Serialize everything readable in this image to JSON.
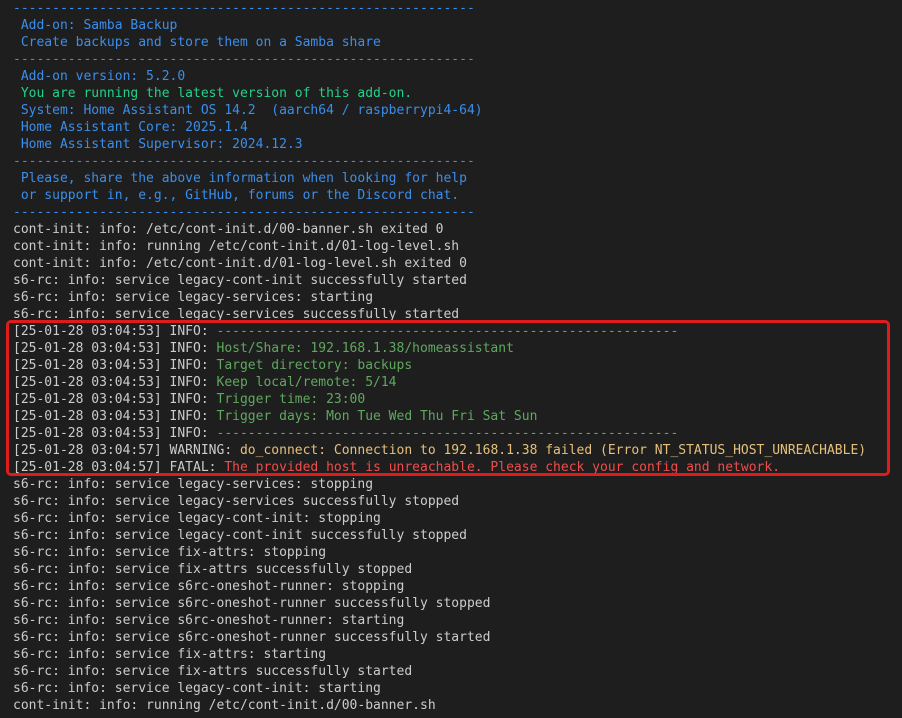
{
  "colors": {
    "background": "#1e1e1e",
    "default": "#cccccc",
    "blue": "#3b8eea",
    "green": "#23d18b",
    "green_dim": "#5fa85f",
    "yellow": "#e5c07b",
    "red": "#f14c4c",
    "highlight_border": "#e01b1b"
  },
  "log_lines": [
    [
      {
        "text": "-----------------------------------------------------------",
        "color": "blue"
      }
    ],
    [
      {
        "text": " Add-on: Samba Backup",
        "color": "blue"
      }
    ],
    [
      {
        "text": " Create backups and store them on a Samba share",
        "color": "blue"
      }
    ],
    [
      {
        "text": "-----------------------------------------------------------",
        "color": "blue"
      }
    ],
    [
      {
        "text": " Add-on version: 5.2.0",
        "color": "blue"
      }
    ],
    [
      {
        "text": " You are running the latest version of this add-on.",
        "color": "green"
      }
    ],
    [
      {
        "text": " System: Home Assistant OS 14.2  (aarch64 / raspberrypi4-64)",
        "color": "blue"
      }
    ],
    [
      {
        "text": " Home Assistant Core: 2025.1.4",
        "color": "blue"
      }
    ],
    [
      {
        "text": " Home Assistant Supervisor: 2024.12.3",
        "color": "blue"
      }
    ],
    [
      {
        "text": "-----------------------------------------------------------",
        "color": "blue"
      }
    ],
    [
      {
        "text": " Please, share the above information when looking for help",
        "color": "blue"
      }
    ],
    [
      {
        "text": " or support in, e.g., GitHub, forums or the Discord chat.",
        "color": "blue"
      }
    ],
    [
      {
        "text": "-----------------------------------------------------------",
        "color": "blue"
      }
    ],
    [
      {
        "text": "cont-init: info: /etc/cont-init.d/00-banner.sh exited 0",
        "color": "white"
      }
    ],
    [
      {
        "text": "cont-init: info: running /etc/cont-init.d/01-log-level.sh",
        "color": "white"
      }
    ],
    [
      {
        "text": "cont-init: info: /etc/cont-init.d/01-log-level.sh exited 0",
        "color": "white"
      }
    ],
    [
      {
        "text": "s6-rc: info: service legacy-cont-init successfully started",
        "color": "white"
      }
    ],
    [
      {
        "text": "s6-rc: info: service legacy-services: starting",
        "color": "white"
      }
    ],
    [
      {
        "text": "s6-rc: info: service legacy-services successfully started",
        "color": "white"
      }
    ],
    [
      {
        "text": "[25-01-28 03:04:53] INFO: ",
        "color": "white"
      },
      {
        "text": "-----------------------------------------------------------",
        "color": "green-dim"
      }
    ],
    [
      {
        "text": "[25-01-28 03:04:53] INFO: ",
        "color": "white"
      },
      {
        "text": "Host/Share: 192.168.1.38/homeassistant",
        "color": "green-dim"
      }
    ],
    [
      {
        "text": "[25-01-28 03:04:53] INFO: ",
        "color": "white"
      },
      {
        "text": "Target directory: backups",
        "color": "green-dim"
      }
    ],
    [
      {
        "text": "[25-01-28 03:04:53] INFO: ",
        "color": "white"
      },
      {
        "text": "Keep local/remote: 5/14",
        "color": "green-dim"
      }
    ],
    [
      {
        "text": "[25-01-28 03:04:53] INFO: ",
        "color": "white"
      },
      {
        "text": "Trigger time: 23:00",
        "color": "green-dim"
      }
    ],
    [
      {
        "text": "[25-01-28 03:04:53] INFO: ",
        "color": "white"
      },
      {
        "text": "Trigger days: Mon Tue Wed Thu Fri Sat Sun",
        "color": "green-dim"
      }
    ],
    [
      {
        "text": "[25-01-28 03:04:53] INFO: ",
        "color": "white"
      },
      {
        "text": "-----------------------------------------------------------",
        "color": "green-dim"
      }
    ],
    [
      {
        "text": "[25-01-28 03:04:57] WARNING: ",
        "color": "white"
      },
      {
        "text": "do_connect: Connection to 192.168.1.38 failed (Error NT_STATUS_HOST_UNREACHABLE)",
        "color": "yellow"
      }
    ],
    [
      {
        "text": "[25-01-28 03:04:57] FATAL: ",
        "color": "white"
      },
      {
        "text": "The provided host is unreachable. Please check your config and network.",
        "color": "red"
      }
    ],
    [
      {
        "text": "s6-rc: info: service legacy-services: stopping",
        "color": "white"
      }
    ],
    [
      {
        "text": "s6-rc: info: service legacy-services successfully stopped",
        "color": "white"
      }
    ],
    [
      {
        "text": "s6-rc: info: service legacy-cont-init: stopping",
        "color": "white"
      }
    ],
    [
      {
        "text": "s6-rc: info: service legacy-cont-init successfully stopped",
        "color": "white"
      }
    ],
    [
      {
        "text": "s6-rc: info: service fix-attrs: stopping",
        "color": "white"
      }
    ],
    [
      {
        "text": "s6-rc: info: service fix-attrs successfully stopped",
        "color": "white"
      }
    ],
    [
      {
        "text": "s6-rc: info: service s6rc-oneshot-runner: stopping",
        "color": "white"
      }
    ],
    [
      {
        "text": "s6-rc: info: service s6rc-oneshot-runner successfully stopped",
        "color": "white"
      }
    ],
    [
      {
        "text": "s6-rc: info: service s6rc-oneshot-runner: starting",
        "color": "white"
      }
    ],
    [
      {
        "text": "s6-rc: info: service s6rc-oneshot-runner successfully started",
        "color": "white"
      }
    ],
    [
      {
        "text": "s6-rc: info: service fix-attrs: starting",
        "color": "white"
      }
    ],
    [
      {
        "text": "s6-rc: info: service fix-attrs successfully started",
        "color": "white"
      }
    ],
    [
      {
        "text": "s6-rc: info: service legacy-cont-init: starting",
        "color": "white"
      }
    ],
    [
      {
        "text": "cont-init: info: running /etc/cont-init.d/00-banner.sh",
        "color": "white"
      }
    ]
  ]
}
